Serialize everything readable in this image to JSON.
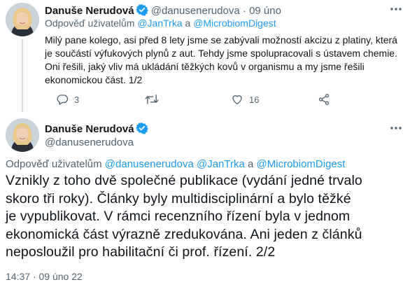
{
  "tweet1": {
    "author_name": "Danuše Nerudová",
    "handle": "@danusenerudova",
    "separator": "·",
    "date": "09 úno",
    "reply_prefix": "Odpověď uživatelům",
    "reply_mention_1": "@JanTrka",
    "reply_and": "a",
    "reply_mention_2": "@MicrobiomDigest",
    "lines": [
      "Milý pane kolego, asi před 8 lety jsme se zabývali možností akcizu z platiny, která",
      "je součástí výfukových plynů z aut. Tehdy jsme spolupracovali s ústavem chemie.",
      "Oni řešili, jaký vliv má ukládání těžkých kovů v organismu a my jsme řešili",
      "ekonomickou část. 1/2"
    ],
    "reply_count": "3",
    "retweet_count": "",
    "like_count": "16"
  },
  "tweet2": {
    "author_name": "Danuše Nerudová",
    "handle": "@danusenerudova",
    "reply_prefix": "Odpověď uživatelům",
    "reply_mention_1": "@danusenerudova",
    "reply_mention_2": "@JanTrka",
    "reply_and": "a",
    "reply_mention_3": "@MicrobiomDigest",
    "lines": [
      "Vznikly z toho dvě společné publikace (vydání jedné trvalo",
      "skoro tři roky). Články byly multidisciplinární a bylo těžké",
      "je vypublikovat. V rámci recenzního řízení byla v jednom",
      "ekonomická část výrazně zredukována. Ani jeden z článků",
      "neposloužil pro habilitační či prof. řízení. 2/2"
    ],
    "time": "14:37",
    "separator": "·",
    "date": "09 úno 22"
  },
  "colors": {
    "link": "#1d9bf0",
    "muted": "#536471",
    "text": "#0f1419",
    "verified": "#1d9bf0"
  },
  "icons": [
    "verified-badge-icon",
    "more-icon",
    "reply-icon",
    "retweet-icon",
    "like-icon",
    "share-icon"
  ]
}
